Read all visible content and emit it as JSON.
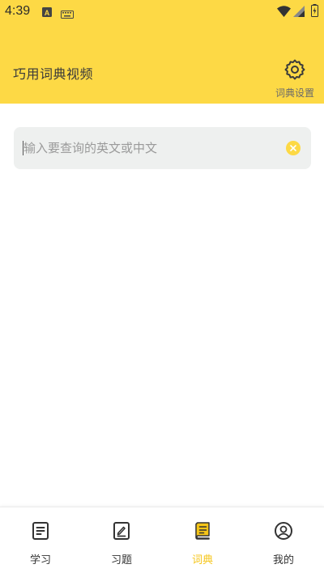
{
  "status_bar": {
    "time": "4:39",
    "icons": [
      "a-letter-icon",
      "keyboard-icon",
      "wifi-icon",
      "signal-icon",
      "battery-charging-icon"
    ]
  },
  "header": {
    "title": "巧用词典视频",
    "settings_label": "词典设置",
    "background_color": "#FDD945"
  },
  "search": {
    "value": "",
    "placeholder": "输入要查询的英文或中文"
  },
  "bottom_nav": {
    "items": [
      {
        "label": "学习",
        "icon": "document-lines-icon",
        "active": false
      },
      {
        "label": "习题",
        "icon": "pen-paper-icon",
        "active": false
      },
      {
        "label": "词典",
        "icon": "book-icon",
        "active": true
      },
      {
        "label": "我的",
        "icon": "user-circle-icon",
        "active": false
      }
    ],
    "active_color": "#F5C518"
  }
}
